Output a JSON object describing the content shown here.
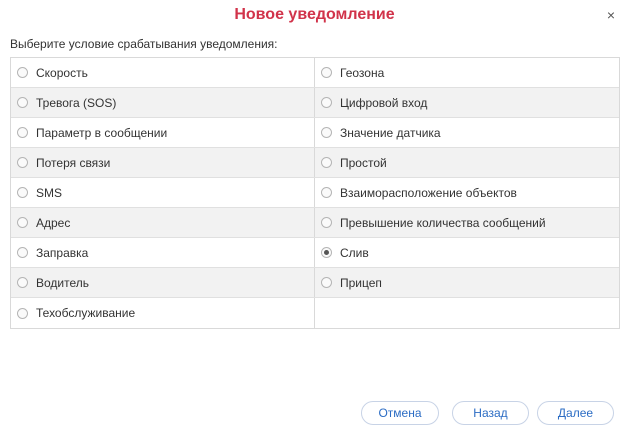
{
  "dialog": {
    "title": "Новое уведомление",
    "close_label": "×",
    "prompt": "Выберите условие срабатывания уведомления:"
  },
  "options": {
    "left": [
      "Скорость",
      "Тревога (SOS)",
      "Параметр в сообщении",
      "Потеря связи",
      "SMS",
      "Адрес",
      "Заправка",
      "Водитель",
      "Техобслуживание"
    ],
    "right": [
      "Геозона",
      "Цифровой вход",
      "Значение датчика",
      "Простой",
      "Взаиморасположение объектов",
      "Превышение количества сообщений",
      "Слив",
      "Прицеп"
    ],
    "selected": "Слив"
  },
  "buttons": {
    "cancel": "Отмена",
    "back": "Назад",
    "next": "Далее"
  },
  "colors": {
    "title": "#d1334a",
    "button_text": "#2b6cc4",
    "alt_row": "#f2f2f2"
  }
}
